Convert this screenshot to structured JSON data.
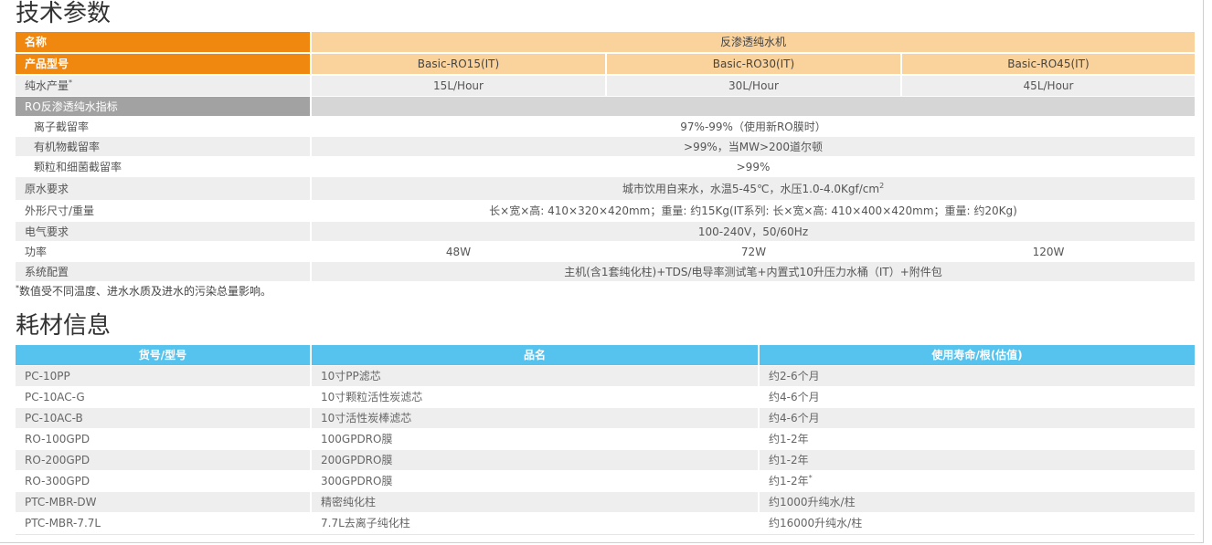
{
  "colors": {
    "orange": "#F0870F",
    "peach": "#FAD29C",
    "row_gray": "#EEEEEE",
    "group_gray": "#A2A2A2",
    "group_fill": "#D6D6D6",
    "header_blue": "#55C3EE",
    "text": "#555555"
  },
  "specs": {
    "title": "技术参数",
    "rows": [
      {
        "label": "名称",
        "value": "反渗透纯水机"
      },
      {
        "label": "产品型号",
        "values": [
          "Basic-RO15(IT)",
          "Basic-RO30(IT)",
          "Basic-RO45(IT)"
        ]
      },
      {
        "label": "纯水产量",
        "label_mark": "*",
        "values": [
          "15L/Hour",
          "30L/Hour",
          "45L/Hour"
        ]
      },
      {
        "label": "RO反渗透纯水指标"
      },
      {
        "label": "离子截留率",
        "value": "97%-99%（使用新RO膜时）"
      },
      {
        "label": "有机物截留率",
        "value": ">99%，当MW>200道尔顿"
      },
      {
        "label": "颗粒和细菌截留率",
        "value": ">99%"
      },
      {
        "label": "原水要求",
        "value": "城市饮用自来水，水温5-45℃，水压1.0-4.0Kgf/cm",
        "value_sup": "2"
      },
      {
        "label": "外形尺寸/重量",
        "value": "长×宽×高: 410×320×420mm；重量: 约15Kg(IT系列: 长×宽×高: 410×400×420mm；重量: 约20Kg)"
      },
      {
        "label": "电气要求",
        "value": "100-240V，50/60Hz"
      },
      {
        "label": "功率",
        "values": [
          "48W",
          "72W",
          "120W"
        ]
      },
      {
        "label": "系统配置",
        "value": "主机(含1套纯化柱)+TDS/电导率测试笔+内置式10升压力水桶（IT）+附件包"
      }
    ],
    "footnote": {
      "mark": "*",
      "text": "数值受不同温度、进水水质及进水的污染总量影响。"
    }
  },
  "consumables": {
    "title": "耗材信息",
    "headers": [
      "货号/型号",
      "品名",
      "使用寿命/根(估值)"
    ],
    "rows": [
      {
        "model": "PC-10PP",
        "name": "10寸PP滤芯",
        "lifespan": "约2-6个月"
      },
      {
        "model": "PC-10AC-G",
        "name": "10寸颗粒活性炭滤芯",
        "lifespan": "约4-6个月"
      },
      {
        "model": "PC-10AC-B",
        "name": "10寸活性炭棒滤芯",
        "lifespan": "约4-6个月"
      },
      {
        "model": "RO-100GPD",
        "name": "100GPDRO膜",
        "lifespan": "约1-2年"
      },
      {
        "model": "RO-200GPD",
        "name": "200GPDRO膜",
        "lifespan": "约1-2年"
      },
      {
        "model": "RO-300GPD",
        "name": "300GPDRO膜",
        "lifespan": "约1-2年",
        "lifespan_mark": "*"
      },
      {
        "model": "PTC-MBR-DW",
        "name": "精密纯化柱",
        "lifespan": "约1000升纯水/柱"
      },
      {
        "model": "PTC-MBR-7.7L",
        "name": "7.7L去离子纯化柱",
        "lifespan": "约16000升纯水/柱"
      }
    ]
  }
}
